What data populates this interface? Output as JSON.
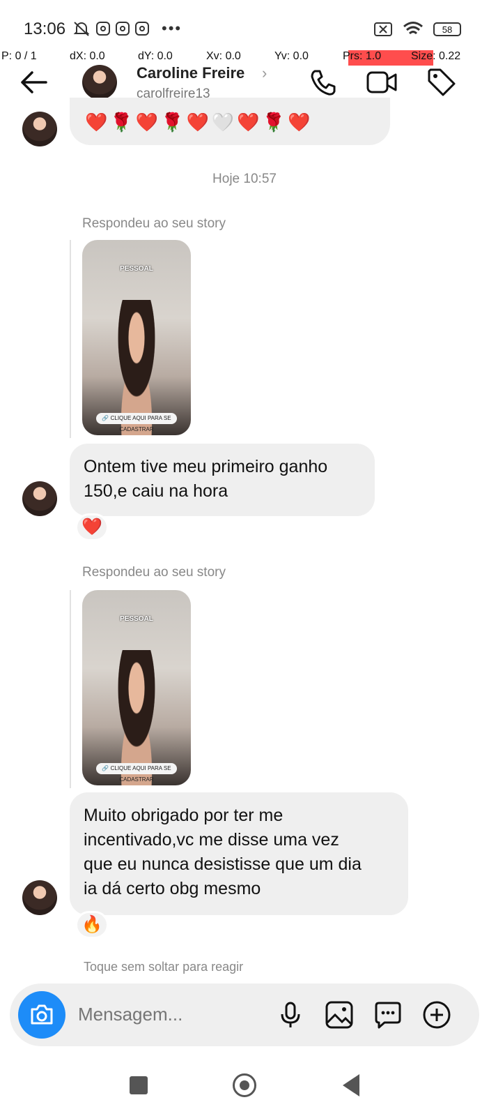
{
  "status_bar": {
    "time": "13:06",
    "dots": "•••",
    "battery": "58"
  },
  "debug": {
    "p": "P: 0 / 1",
    "dx": "dX: 0.0",
    "dy": "dY: 0.0",
    "xv": "Xv: 0.0",
    "yv": "Yv: 0.0",
    "prs": "Prs: 1.0",
    "size": "Size: 0.22"
  },
  "header": {
    "name": "Caroline Freire",
    "chevron": "›",
    "username": "carolfreire13"
  },
  "top_bubble_emojis": [
    "❤️",
    "🌹",
    "❤️",
    "🌹",
    "❤️",
    "🤍",
    "❤️",
    "🌹",
    "❤️"
  ],
  "timestamp": "Hoje 10:57",
  "stories": [
    {
      "label": "Respondeu ao seu story",
      "tag": "PESSOAL",
      "cta": "🔗 CLIQUE AQUI PARA SE CADASTRAR"
    },
    {
      "label": "Respondeu ao seu story",
      "tag": "PESSOAL",
      "cta": "🔗 CLIQUE AQUI PARA SE CADASTRAR"
    }
  ],
  "messages": [
    {
      "lines": [
        "Ontem tive meu primeiro ganho",
        "150,e caiu na hora"
      ],
      "reaction": "❤️"
    },
    {
      "lines": [
        "Muito obrigado por ter me",
        "incentivado,vc me disse uma vez",
        "que eu nunca desistisse que um dia",
        "ia dá certo obg mesmo"
      ],
      "reaction": "🔥"
    }
  ],
  "hint": "Toque sem soltar para reagir",
  "composer": {
    "placeholder": "Mensagem..."
  },
  "icons": {
    "back": "back-arrow-icon",
    "call": "phone-icon",
    "video": "video-call-icon",
    "tag": "tag-icon",
    "camera": "camera-icon",
    "mic": "microphone-icon",
    "gallery": "gallery-icon",
    "sticker": "chat-bubble-icon",
    "plus": "plus-circle-icon"
  },
  "colors": {
    "accent": "#1d8cf8",
    "bubble": "#efefef",
    "debug_highlight": "#ff4d4d"
  }
}
